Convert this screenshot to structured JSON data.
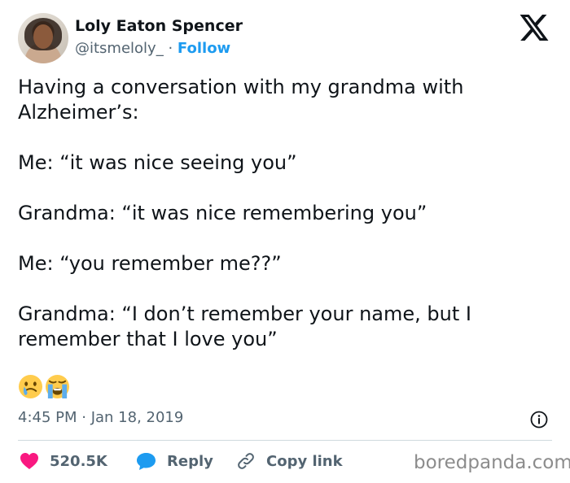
{
  "author": {
    "name": "Loly Eaton Spencer",
    "handle": "@itsmeloly_",
    "separator": "·",
    "follow_label": "Follow"
  },
  "tweet": {
    "text": "Having a conversation with my grandma with\nAlzheimer’s:\n\nMe: “it was nice seeing you”\n\nGrandma: “it was nice remembering you”\n\nMe: “you remember me??”\n\nGrandma: “I don’t remember your name, but I\nremember that I love you”",
    "emojis": [
      "crying-face",
      "loudly-crying-face"
    ],
    "timestamp": "4:45 PM · Jan 18, 2019"
  },
  "actions": {
    "likes": "520.5K",
    "reply_label": "Reply",
    "copy_link_label": "Copy link"
  },
  "watermark": "boredpanda.com",
  "icons": {
    "platform_logo": "x-logo-icon",
    "info": "info-icon",
    "like": "heart-icon",
    "reply": "reply-bubble-icon",
    "copy": "link-icon"
  },
  "colors": {
    "accent": "#1d9bf0",
    "like": "#f91880",
    "muted": "#536471",
    "text": "#0f1419"
  }
}
